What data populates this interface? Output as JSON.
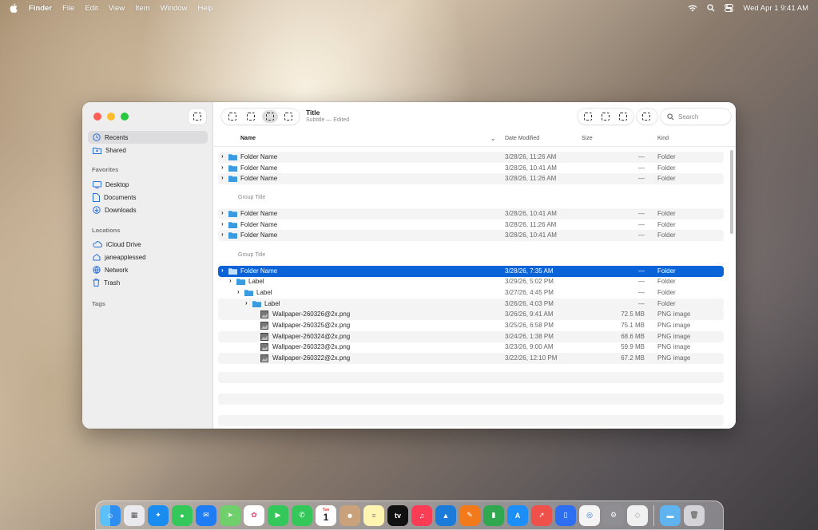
{
  "menubar": {
    "app_name": "Finder",
    "menus": [
      "File",
      "Edit",
      "View",
      "Item",
      "Window",
      "Help"
    ],
    "clock": "Wed Apr 1  9:41 AM"
  },
  "window": {
    "title": "Title",
    "subtitle": "Subtitle — Edited",
    "search_placeholder": "Search"
  },
  "sidebar": {
    "top_items": [
      {
        "label": "Recents",
        "icon": "clock-icon"
      },
      {
        "label": "Shared",
        "icon": "shared-folder-icon"
      }
    ],
    "favorites_heading": "Favorites",
    "favorites": [
      {
        "label": "Desktop",
        "icon": "desktop-icon"
      },
      {
        "label": "Documents",
        "icon": "document-icon"
      },
      {
        "label": "Downloads",
        "icon": "download-icon"
      }
    ],
    "locations_heading": "Locations",
    "locations": [
      {
        "label": "iCloud Drive",
        "icon": "cloud-icon"
      },
      {
        "label": "janeapplessed",
        "icon": "home-icon"
      },
      {
        "label": "Network",
        "icon": "globe-icon"
      },
      {
        "label": "Trash",
        "icon": "trash-icon"
      }
    ],
    "tags_heading": "Tags"
  },
  "columns": {
    "name": "Name",
    "date": "Date Modified",
    "size": "Size",
    "kind": "Kind"
  },
  "group_titles": [
    "Group Title",
    "Group Title"
  ],
  "rows": [
    {
      "name": "Folder Name",
      "date": "3/28/26, 11:26 AM",
      "size": "—",
      "kind": "Folder"
    },
    {
      "name": "Folder Name",
      "date": "3/28/26, 10:41 AM",
      "size": "—",
      "kind": "Folder"
    },
    {
      "name": "Folder Name",
      "date": "3/28/26, 11:26 AM",
      "size": "—",
      "kind": "Folder"
    },
    {
      "name": "Folder Name",
      "date": "3/28/26, 10:41 AM",
      "size": "—",
      "kind": "Folder"
    },
    {
      "name": "Folder Name",
      "date": "3/28/26, 11:26 AM",
      "size": "—",
      "kind": "Folder"
    },
    {
      "name": "Folder Name",
      "date": "3/28/26, 10:41 AM",
      "size": "—",
      "kind": "Folder"
    },
    {
      "name": "Folder Name",
      "date": "3/28/26, 7:35 AM",
      "size": "—",
      "kind": "Folder"
    },
    {
      "name": "Label",
      "date": "3/29/26, 5:02 PM",
      "size": "—",
      "kind": "Folder"
    },
    {
      "name": "Label",
      "date": "3/27/26, 4:45 PM",
      "size": "—",
      "kind": "Folder"
    },
    {
      "name": "Label",
      "date": "3/26/26, 4:03 PM",
      "size": "—",
      "kind": "Folder"
    },
    {
      "name": "Wallpaper-260326@2x.png",
      "date": "3/26/26, 9:41 AM",
      "size": "72.5 MB",
      "kind": "PNG image"
    },
    {
      "name": "Wallpaper-260325@2x.png",
      "date": "3/25/26, 6:58 PM",
      "size": "75.1 MB",
      "kind": "PNG image"
    },
    {
      "name": "Wallpaper-260324@2x.png",
      "date": "3/24/26, 1:38 PM",
      "size": "68.6 MB",
      "kind": "PNG image"
    },
    {
      "name": "Wallpaper-260323@2x.png",
      "date": "3/23/26, 9:00 AM",
      "size": "59.9 MB",
      "kind": "PNG image"
    },
    {
      "name": "Wallpaper-260322@2x.png",
      "date": "3/22/26, 12:10 PM",
      "size": "67.2 MB",
      "kind": "PNG image"
    }
  ],
  "dock": {
    "calendar_month": "Tue",
    "calendar_day": "1",
    "tv_label": "tv",
    "apps": [
      "finder-icon",
      "launchpad-icon",
      "safari-icon",
      "messages-icon",
      "mail-icon",
      "maps-icon",
      "photos-icon",
      "facetime-icon",
      "phone-icon",
      "calendar-icon",
      "contacts-icon",
      "notes-icon",
      "apple-tv-icon",
      "music-icon",
      "keynote-icon",
      "pages-icon",
      "numbers-icon",
      "app-store-icon",
      "rocket-icon",
      "simulator-icon",
      "accessibility-icon",
      "system-settings-icon",
      "preview-icon",
      "downloads-folder-icon",
      "trash-icon"
    ]
  },
  "colors": {
    "selection": "#0a64d8",
    "folder": "#3a9be0",
    "accent_red": "#fe5f57",
    "accent_yellow": "#febc2e",
    "accent_green": "#28c840"
  }
}
